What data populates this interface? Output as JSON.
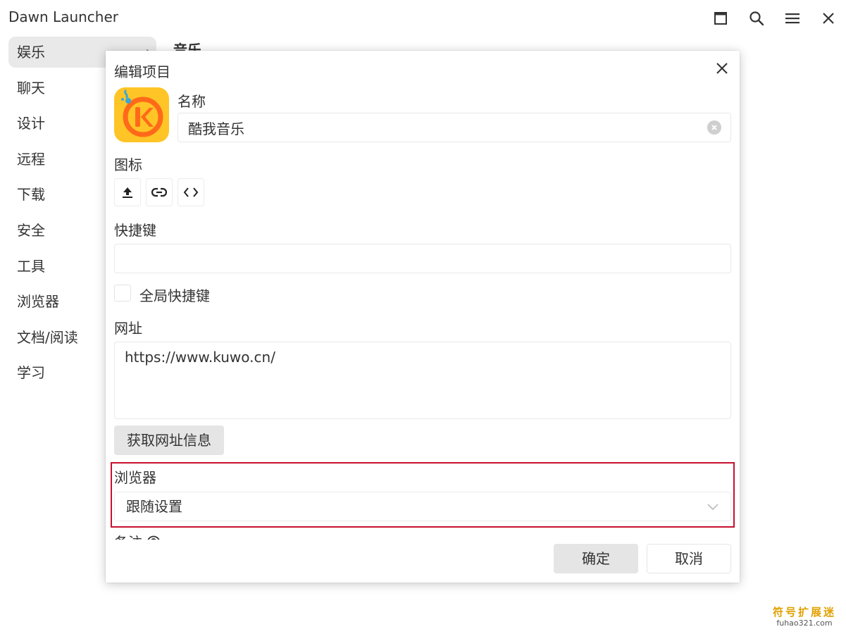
{
  "window": {
    "title": "Dawn Launcher"
  },
  "sidebar": {
    "items": [
      {
        "label": "娱乐"
      },
      {
        "label": "聊天"
      },
      {
        "label": "设计"
      },
      {
        "label": "远程"
      },
      {
        "label": "下载"
      },
      {
        "label": "安全"
      },
      {
        "label": "工具"
      },
      {
        "label": "浏览器"
      },
      {
        "label": "文档/阅读"
      },
      {
        "label": "学习"
      }
    ]
  },
  "content": {
    "title": "音乐"
  },
  "dialog": {
    "title": "编辑项目",
    "name_label": "名称",
    "name_value": "酷我音乐",
    "icon_label": "图标",
    "hotkey_label": "快捷键",
    "hotkey_value": "",
    "global_hotkey_label": "全局快捷键",
    "url_label": "网址",
    "url_value": "https://www.kuwo.cn/",
    "fetch_button": "获取网址信息",
    "browser_label": "浏览器",
    "browser_value": "跟随设置",
    "remark_label": "备注",
    "ok_button": "确定",
    "cancel_button": "取消"
  },
  "watermark": {
    "cn": "符号扩展迷",
    "en": "fuhao321.com"
  },
  "icons": {
    "maximize": "maximize-icon",
    "search": "search-icon",
    "menu": "menu-icon",
    "close": "close-icon",
    "upload": "upload-icon",
    "link": "link-icon",
    "code": "code-icon"
  },
  "colors": {
    "highlight": "#c8102e",
    "app_icon_yellow": "#ffc526",
    "app_icon_orange": "#ff6a1a"
  }
}
